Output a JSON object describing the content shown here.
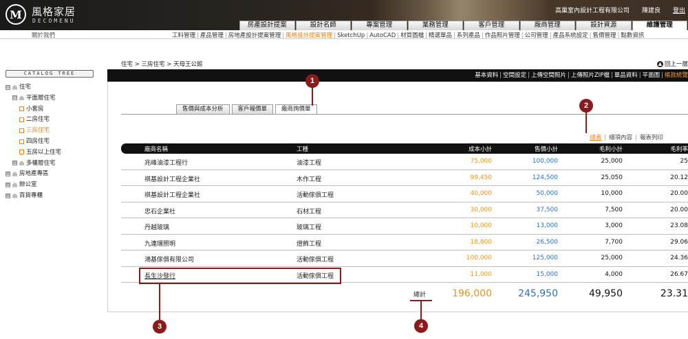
{
  "header": {
    "logo_mark": "M",
    "logo_name": "風格家居",
    "logo_sub": "DECOMENU",
    "company": "高巢室內設計工程有限公司",
    "user": "陳建良",
    "logout": "登出"
  },
  "main_nav": [
    {
      "label": "房產設計提案",
      "active": false
    },
    {
      "label": "設計名師",
      "active": false
    },
    {
      "label": "專案管理",
      "active": false
    },
    {
      "label": "業務管理",
      "active": false
    },
    {
      "label": "客戶管理",
      "active": false
    },
    {
      "label": "廠商管理",
      "active": false
    },
    {
      "label": "設計資源",
      "active": false
    },
    {
      "label": "維護管理",
      "active": true
    }
  ],
  "sub_nav": {
    "about": "關於我們",
    "items": [
      "工料管理",
      "產品管理",
      "房地產設計提案管理",
      "風格設計提案管理",
      "SketchUp",
      "AutoCAD",
      "材質圖檔",
      "精選單品",
      "系列產品",
      "作品照片管理",
      "公司管理",
      "產品系統設定",
      "售價管理",
      "點數資訊"
    ],
    "active_index": 3
  },
  "sidebar": {
    "catalog_title": "CATALOG TREE",
    "tree": [
      {
        "label": "住宅",
        "toggle": "⊟",
        "kind": "root"
      },
      {
        "label": "平面層住宅",
        "toggle": "⊟",
        "kind": "folder"
      },
      {
        "label": "小套房",
        "kind": "leaf",
        "active": false
      },
      {
        "label": "二房住宅",
        "kind": "leaf",
        "active": false
      },
      {
        "label": "三房住宅",
        "kind": "leaf",
        "active": true
      },
      {
        "label": "四房住宅",
        "kind": "leaf",
        "active": false
      },
      {
        "label": "五房以上住宅",
        "kind": "leaf",
        "active": false
      },
      {
        "label": "多樓層住宅",
        "toggle": "⊞",
        "kind": "folder"
      },
      {
        "label": "房地產專區",
        "toggle": "⊞",
        "kind": "root"
      },
      {
        "label": "辦公室",
        "toggle": "⊞",
        "kind": "root"
      },
      {
        "label": "百貨專櫃",
        "toggle": "⊞",
        "kind": "root"
      }
    ]
  },
  "breadcrumb": "住宅 > 三房住宅 > 天母王公館",
  "back_label": "回上一層",
  "toolbar_links": [
    "基本資料",
    "空間設定",
    "上傳空間照片",
    "上傳照片ZIP檔",
    "單品資料",
    "平面圖",
    "帳款統覽"
  ],
  "tabs": [
    {
      "label": "售價與成本分析",
      "active": false
    },
    {
      "label": "客戶報價單",
      "active": false
    },
    {
      "label": "廠商詢價單",
      "active": true
    }
  ],
  "view_actions": [
    {
      "label": "總表",
      "active": true
    },
    {
      "label": "細項內容",
      "active": false
    },
    {
      "label": "報表列印",
      "active": false
    }
  ],
  "table": {
    "columns": [
      "廠商名稱",
      "工種",
      "成本小計",
      "售價小計",
      "毛利小計",
      "毛利率"
    ],
    "rows": [
      {
        "vendor": "兆峰油漆工程行",
        "type": "油漆工程",
        "cost": "75,000",
        "price": "100,000",
        "profit": "25,000",
        "rate": "25"
      },
      {
        "vendor": "祺基設計工程企業社",
        "type": "木作工程",
        "cost": "99,450",
        "price": "124,500",
        "profit": "25,050",
        "rate": "20.12"
      },
      {
        "vendor": "祺基設計工程企業社",
        "type": "活動傢俱工程",
        "cost": "40,000",
        "price": "50,000",
        "profit": "10,000",
        "rate": "20.00"
      },
      {
        "vendor": "忠石企業社",
        "type": "石材工程",
        "cost": "30,000",
        "price": "37,500",
        "profit": "7,500",
        "rate": "20.00"
      },
      {
        "vendor": "丹越玻璃",
        "type": "玻璃工程",
        "cost": "10,000",
        "price": "13,000",
        "profit": "3,000",
        "rate": "23.08"
      },
      {
        "vendor": "九連環照明",
        "type": "燈飾工程",
        "cost": "18,800",
        "price": "26,500",
        "profit": "7,700",
        "rate": "29.06"
      },
      {
        "vendor": "鴻基傢俱有限公司",
        "type": "活動傢俱工程",
        "cost": "100,000",
        "price": "125,000",
        "profit": "25,000",
        "rate": "24.36"
      },
      {
        "vendor": "長生沙發行",
        "type": "活動傢俱工程",
        "cost": "11,000",
        "price": "15,000",
        "profit": "4,000",
        "rate": "26.67"
      }
    ],
    "total_label": "總計",
    "totals": {
      "cost": "196,000",
      "price": "245,950",
      "profit": "49,950",
      "rate": "23.31"
    }
  },
  "markers": [
    "1",
    "2",
    "3",
    "4"
  ],
  "colors": {
    "accent": "#e8821e",
    "link_blue": "#2a6fc7",
    "marker": "#8b1a1a"
  }
}
